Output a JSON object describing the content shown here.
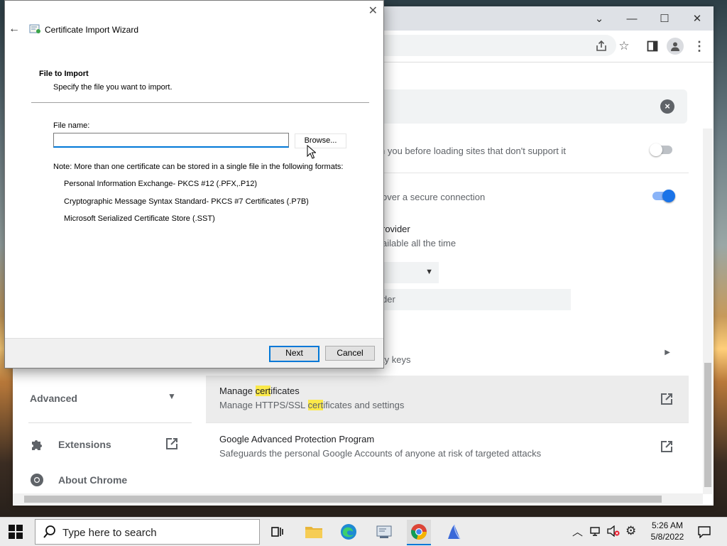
{
  "chrome": {
    "window_controls": {
      "tabsearch": "⌄",
      "minimize": "—",
      "maximize": "☐",
      "close": "✕"
    },
    "settings": {
      "advanced_label": "Advanced",
      "nav": [
        {
          "label": "Extensions",
          "icon": "puzzle-icon"
        },
        {
          "label": "About Chrome",
          "icon": "chrome-logo-icon"
        }
      ],
      "https_text": "n you before loading sites that don't support it",
      "secure_dns_text": "over a secure connection",
      "provider_title": "rovider",
      "provider_sub": "ailable all the time",
      "provider_field": "der",
      "security_keys": "ty keys",
      "manage_certs": {
        "title_pre": "Manage ",
        "title_hl": "cert",
        "title_post": "ificates",
        "sub_pre": "Manage HTTPS/SSL ",
        "sub_hl": "cert",
        "sub_post": "ificates and settings"
      },
      "gapp": {
        "title": "Google Advanced Protection Program",
        "sub": "Safeguards the personal Google Accounts of anyone at risk of targeted attacks"
      }
    }
  },
  "dialog": {
    "title": "Certificate Import Wizard",
    "heading": "File to Import",
    "subheading": "Specify the file you want to import.",
    "file_label": "File name:",
    "file_value": "",
    "browse_label": "Browse...",
    "note": "Note:  More than one certificate can be stored in a single file in the following formats:",
    "formats": [
      "Personal Information Exchange- PKCS #12 (.PFX,.P12)",
      "Cryptographic Message Syntax Standard- PKCS #7 Certificates (.P7B)",
      "Microsoft Serialized Certificate Store (.SST)"
    ],
    "next_label": "Next",
    "cancel_label": "Cancel"
  },
  "taskbar": {
    "search_placeholder": "Type here to search",
    "time": "5:26 AM",
    "date": "5/8/2022"
  },
  "colors": {
    "accent": "#1a73e8",
    "highlight": "#fbe94a",
    "dialog_focus": "#0078d7"
  }
}
